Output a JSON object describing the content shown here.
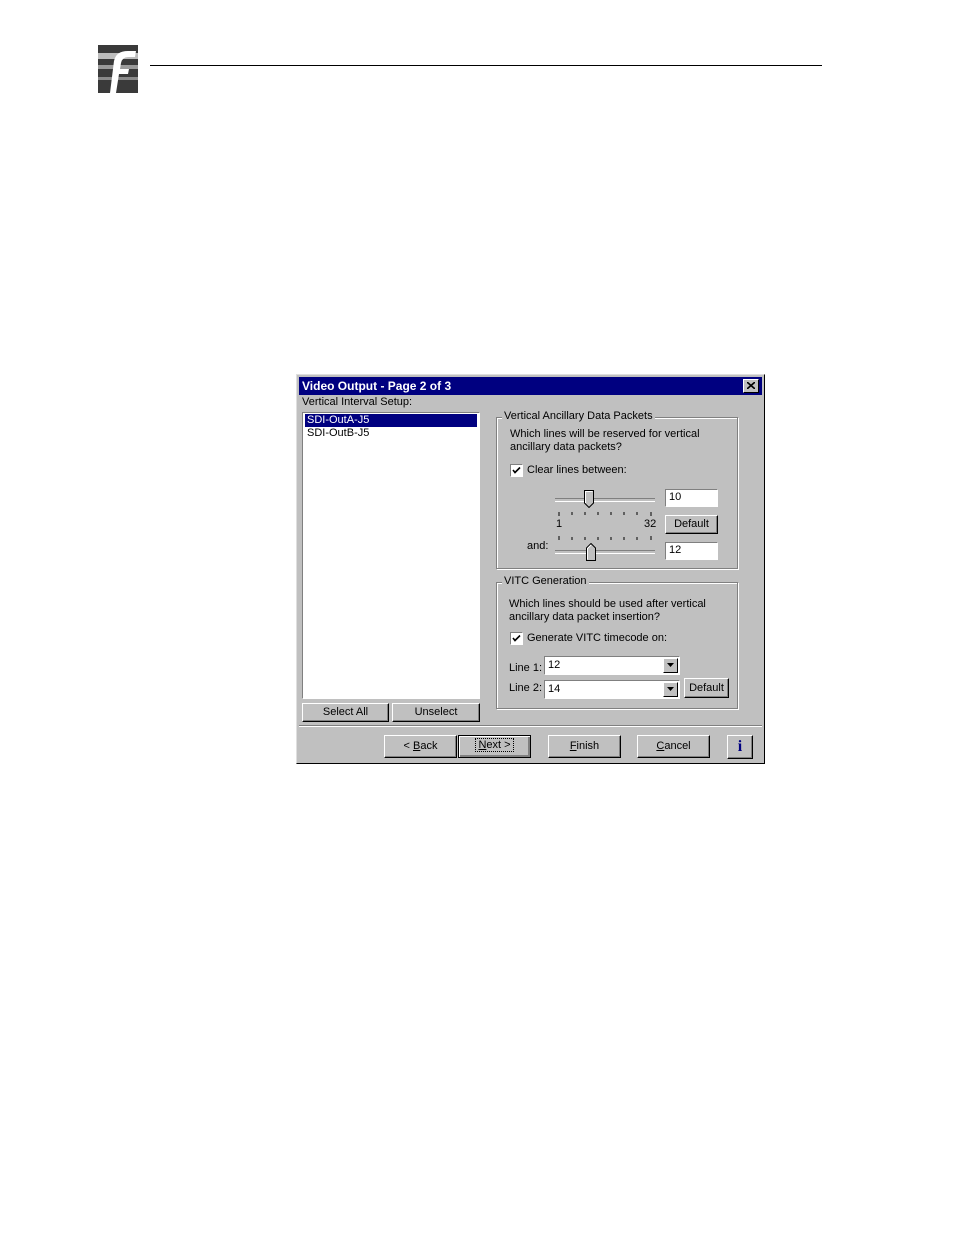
{
  "header": {
    "logo_icon": "company-logo-icon"
  },
  "dialog": {
    "title": "Video Output - Page 2 of 3",
    "close_icon": "close-icon",
    "list_label": "Vertical Interval Setup:",
    "list_items": [
      {
        "label": "SDI-OutA-J5",
        "selected": true
      },
      {
        "label": "SDI-OutB-J5",
        "selected": false
      }
    ],
    "select_all": "Select All",
    "unselect": "Unselect",
    "vanc": {
      "title": "Vertical Ancillary Data Packets",
      "question_line1": "Which lines will be reserved for vertical",
      "question_line2": "ancillary data packets?",
      "checkbox_label": "Clear lines between:",
      "checked": true,
      "slider1_value": "10",
      "slider_min": "1",
      "slider_max": "32",
      "and_label": "and:",
      "slider2_value": "12",
      "default_label": "Default"
    },
    "vitc": {
      "title": "VITC Generation",
      "question_line1": "Which lines should be used after vertical",
      "question_line2": "ancillary data packet insertion?",
      "checkbox_label": "Generate VITC timecode on:",
      "checked": true,
      "line1_label": "Line 1:",
      "line1_value": "12",
      "line2_label": "Line 2:",
      "line2_value": "14",
      "default_label": "Default"
    },
    "footer": {
      "back_key": "B",
      "back_rest": "ack",
      "next_key": "N",
      "next_rest": "ext",
      "finish_key": "F",
      "finish_rest": "inish",
      "cancel_key": "C",
      "cancel_rest": "ancel",
      "info_glyph": "i"
    },
    "colors": {
      "titlebar": "#000080",
      "face": "#c0c0c0",
      "selection": "#000080"
    }
  }
}
